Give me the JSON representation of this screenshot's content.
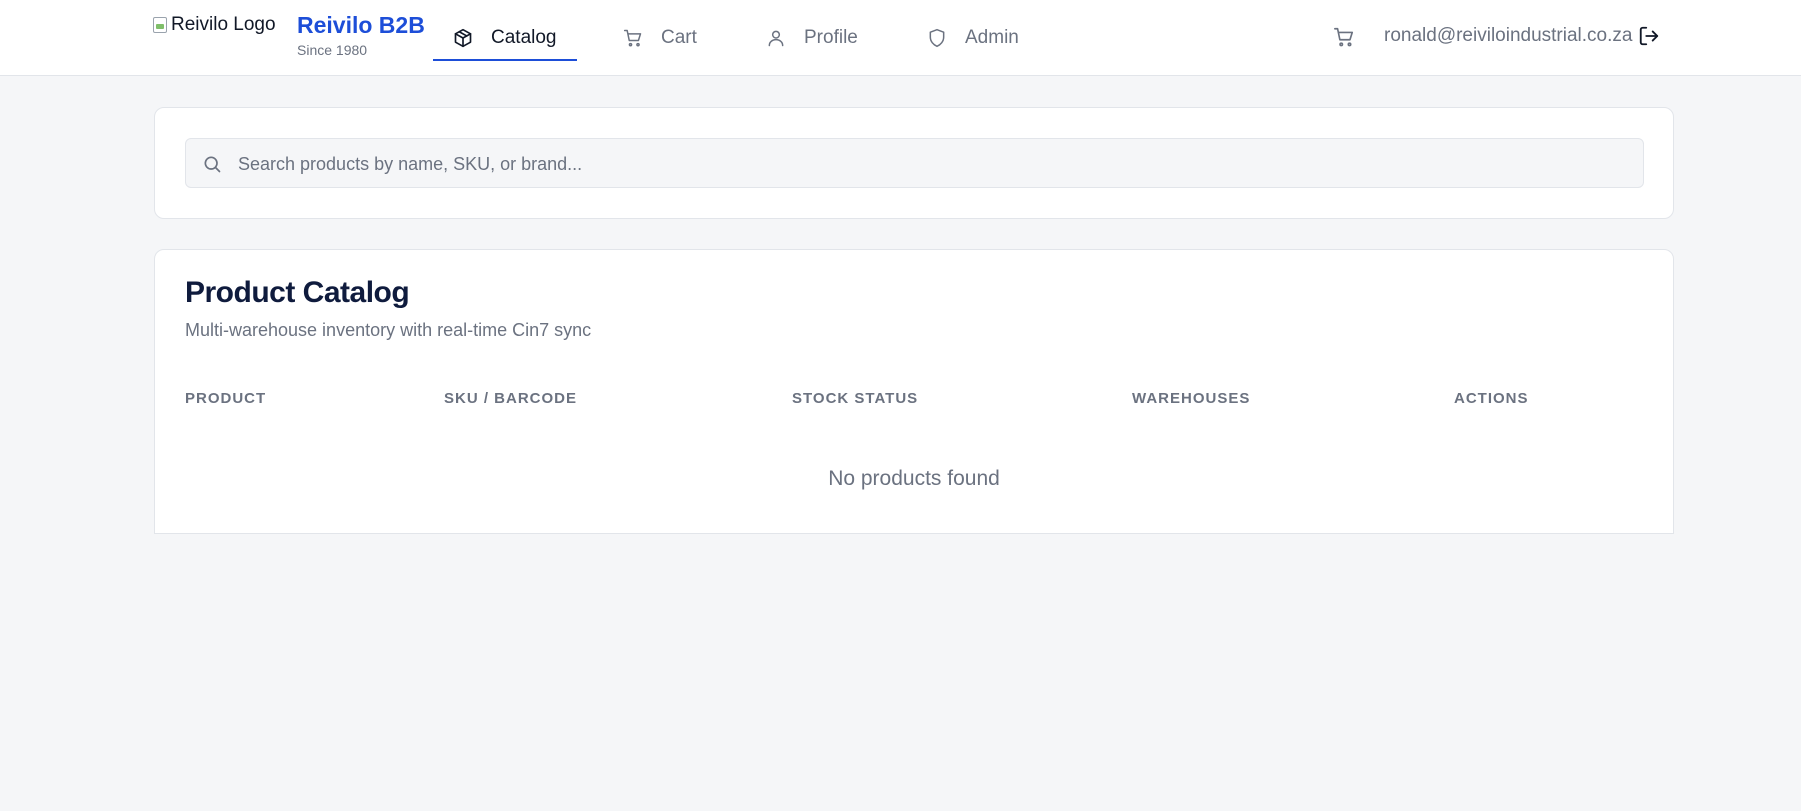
{
  "header": {
    "logo_alt": "Reivilo Logo",
    "brand": "Reivilo B2B",
    "tagline": "Since 1980",
    "nav": [
      {
        "label": "Catalog",
        "icon": "package-icon",
        "active": true
      },
      {
        "label": "Cart",
        "icon": "cart-icon",
        "active": false
      },
      {
        "label": "Profile",
        "icon": "user-icon",
        "active": false
      },
      {
        "label": "Admin",
        "icon": "shield-icon",
        "active": false
      }
    ],
    "cart_icon": "cart-icon",
    "user_email": "ronald@reiviloindustrial.co.za",
    "logout_icon": "logout-icon"
  },
  "search": {
    "placeholder": "Search products by name, SKU, or brand...",
    "value": "",
    "icon": "search-icon"
  },
  "catalog": {
    "title": "Product Catalog",
    "subtitle": "Multi-warehouse inventory with real-time Cin7 sync",
    "columns": [
      "PRODUCT",
      "SKU / BARCODE",
      "STOCK STATUS",
      "WAREHOUSES",
      "ACTIONS"
    ],
    "empty_message": "No products found"
  },
  "colors": {
    "accent": "#1d4ed8",
    "background": "#f5f6f8",
    "muted_text": "#6b7280",
    "heading": "#0f1b3d"
  }
}
